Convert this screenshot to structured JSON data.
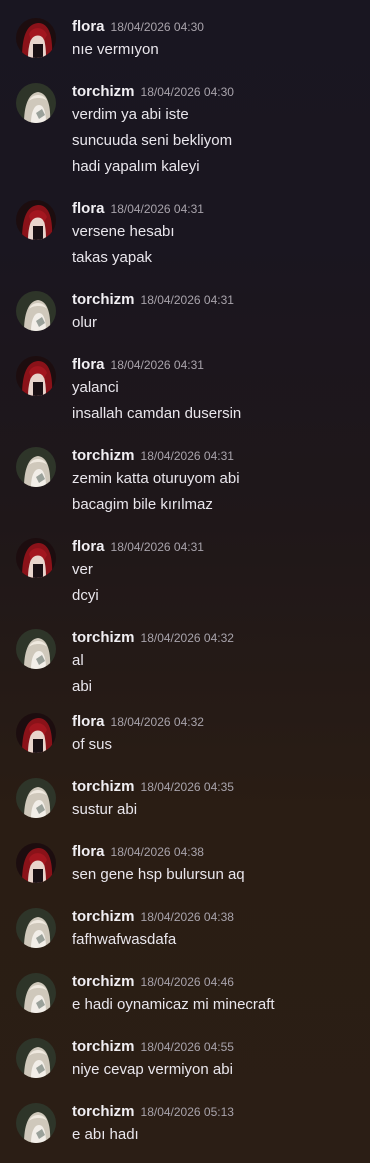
{
  "messages": [
    {
      "user": "flora",
      "time": "18/04/2026 04:30",
      "lines": [
        "nıe vermıyon"
      ]
    },
    {
      "user": "torchizm",
      "time": "18/04/2026 04:30",
      "lines": [
        "verdim ya abi iste",
        "suncuuda seni bekliyom",
        "hadi yapalım kaleyi"
      ]
    },
    {
      "user": "flora",
      "time": "18/04/2026 04:31",
      "lines": [
        "versene hesabı",
        "takas yapak"
      ]
    },
    {
      "user": "torchizm",
      "time": "18/04/2026 04:31",
      "lines": [
        "olur"
      ]
    },
    {
      "user": "flora",
      "time": "18/04/2026 04:31",
      "lines": [
        "yalanci",
        "insallah camdan dusersin"
      ]
    },
    {
      "user": "torchizm",
      "time": "18/04/2026 04:31",
      "lines": [
        "zemin katta oturuyom abi",
        "bacagim bile kırılmaz"
      ]
    },
    {
      "user": "flora",
      "time": "18/04/2026 04:31",
      "lines": [
        "ver",
        "dcyi"
      ]
    },
    {
      "user": "torchizm",
      "time": "18/04/2026 04:32",
      "lines": [
        "al",
        "abi"
      ]
    },
    {
      "user": "flora",
      "time": "18/04/2026 04:32",
      "lines": [
        "of sus"
      ]
    },
    {
      "user": "torchizm",
      "time": "18/04/2026 04:35",
      "lines": [
        "sustur abi"
      ]
    },
    {
      "user": "flora",
      "time": "18/04/2026 04:38",
      "lines": [
        "sen gene hsp bulursun aq"
      ]
    },
    {
      "user": "torchizm",
      "time": "18/04/2026 04:38",
      "lines": [
        "fafhwafwasdafa"
      ]
    },
    {
      "user": "torchizm",
      "time": "18/04/2026 04:46",
      "lines": [
        "e hadi oynamicaz mi minecraft"
      ]
    },
    {
      "user": "torchizm",
      "time": "18/04/2026 04:55",
      "lines": [
        "niye cevap vermiyon abi"
      ]
    },
    {
      "user": "torchizm",
      "time": "18/04/2026 05:13",
      "lines": [
        "e abı hadı"
      ]
    }
  ],
  "avatars": {
    "flora": {
      "icon": "avatar-flora-red-hair",
      "colors": [
        "#7a1418",
        "#2a0d10"
      ]
    },
    "torchizm": {
      "icon": "avatar-torchizm-light-hair",
      "colors": [
        "#d8d2c6",
        "#2f3a2c"
      ]
    }
  }
}
